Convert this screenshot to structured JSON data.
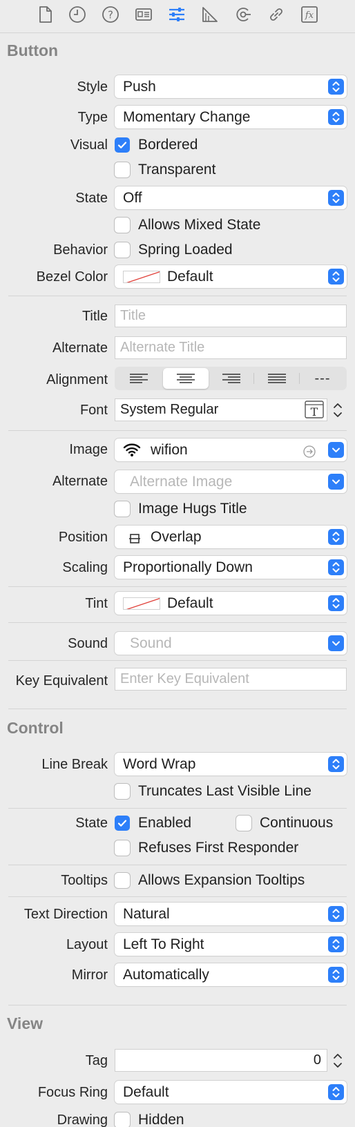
{
  "toolbar": {
    "icons": [
      "file-icon",
      "history-icon",
      "help-icon",
      "identity-icon",
      "attributes-icon",
      "size-ruler-icon",
      "connections-icon",
      "bindings-icon",
      "effects-icon"
    ],
    "active_color": "#2d7ff9"
  },
  "button_section": {
    "title": "Button",
    "style_label": "Style",
    "style_value": "Push",
    "type_label": "Type",
    "type_value": "Momentary Change",
    "visual_label": "Visual",
    "bordered_label": "Bordered",
    "bordered_checked": true,
    "transparent_label": "Transparent",
    "transparent_checked": false,
    "state_label": "State",
    "state_value": "Off",
    "allows_mixed_label": "Allows Mixed State",
    "behavior_label": "Behavior",
    "spring_loaded_label": "Spring Loaded",
    "bezel_label": "Bezel Color",
    "bezel_value": "Default",
    "title_label": "Title",
    "title_placeholder": "Title",
    "alternate_label": "Alternate",
    "alternate_placeholder": "Alternate Title",
    "alignment_label": "Alignment",
    "alignment_options": [
      "align-left",
      "align-center",
      "align-right",
      "align-justified",
      "align-natural"
    ],
    "alignment_natural_text": "---",
    "alignment_selected": "align-center",
    "font_label": "Font",
    "font_value": "System Regular",
    "image_label": "Image",
    "image_value": "wifion",
    "alt_image_label": "Alternate",
    "alt_image_placeholder": "Alternate Image",
    "hugs_title_label": "Image Hugs Title",
    "position_label": "Position",
    "position_value": "Overlap",
    "scaling_label": "Scaling",
    "scaling_value": "Proportionally Down",
    "tint_label": "Tint",
    "tint_value": "Default",
    "sound_label": "Sound",
    "sound_placeholder": "Sound",
    "key_label": "Key Equivalent",
    "key_placeholder": "Enter Key Equivalent"
  },
  "control_section": {
    "title": "Control",
    "line_break_label": "Line Break",
    "line_break_value": "Word Wrap",
    "truncates_label": "Truncates Last Visible Line",
    "state_label": "State",
    "enabled_label": "Enabled",
    "enabled_checked": true,
    "continuous_label": "Continuous",
    "refuses_label": "Refuses First Responder",
    "tooltips_label": "Tooltips",
    "expansion_label": "Allows Expansion Tooltips",
    "text_direction_label": "Text Direction",
    "text_direction_value": "Natural",
    "layout_label": "Layout",
    "layout_value": "Left To Right",
    "mirror_label": "Mirror",
    "mirror_value": "Automatically"
  },
  "view_section": {
    "title": "View",
    "tag_label": "Tag",
    "tag_value": "0",
    "focus_ring_label": "Focus Ring",
    "focus_ring_value": "Default",
    "drawing_label": "Drawing",
    "hidden_label": "Hidden"
  },
  "colors": {
    "accent": "#2d7ff9",
    "background": "#ececec",
    "section_title": "#858585"
  }
}
